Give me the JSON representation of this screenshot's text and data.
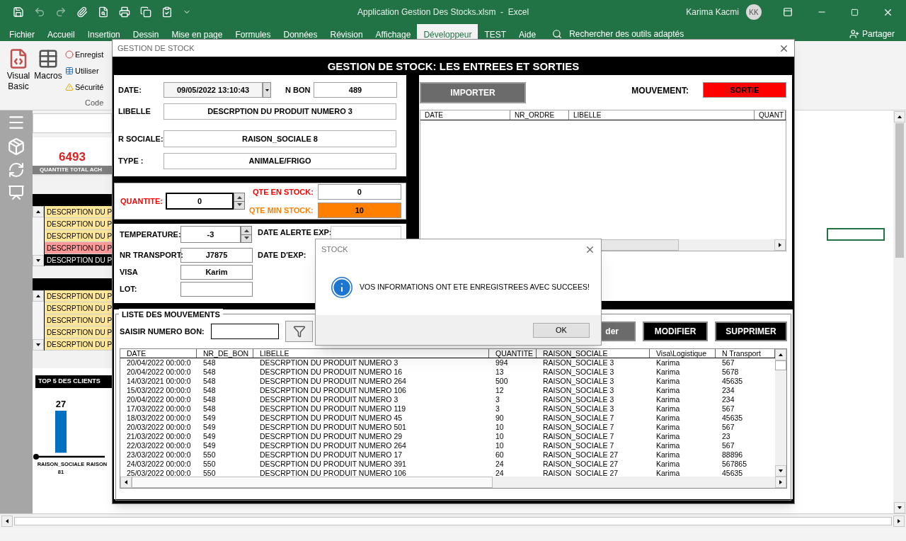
{
  "title_bar": {
    "title": "Application Gestion Des Stocks.xlsm  -  Excel",
    "user": "Karima Kacmi",
    "avatar": "KK"
  },
  "ribbon_tabs": [
    {
      "label": "Fichier",
      "selected": false
    },
    {
      "label": "Accueil",
      "selected": false
    },
    {
      "label": "Insertion",
      "selected": false
    },
    {
      "label": "Dessin",
      "selected": false
    },
    {
      "label": "Mise en page",
      "selected": false
    },
    {
      "label": "Formules",
      "selected": false
    },
    {
      "label": "Données",
      "selected": false
    },
    {
      "label": "Révision",
      "selected": false
    },
    {
      "label": "Affichage",
      "selected": false
    },
    {
      "label": "Développeur",
      "selected": true
    },
    {
      "label": "TEST",
      "selected": false
    },
    {
      "label": "Aide",
      "selected": false
    }
  ],
  "search": {
    "placeholder": "Rechercher des outils adaptés"
  },
  "share": "Partager",
  "ribbon": {
    "buttons": [
      "Visual Basic",
      "Macros"
    ],
    "commands": [
      "Enregist",
      "Utiliser",
      "Sécurité"
    ],
    "group": "Code"
  },
  "dashboard": {
    "kpi_value": "6493",
    "kpi_label": "QUANTITE TOTAL ACH",
    "list_1": [
      {
        "text": "DESCRPTION DU P",
        "color": "#ffe699"
      },
      {
        "text": "DESCRPTION DU P",
        "color": "#ffe699"
      },
      {
        "text": "DESCRPTION DU P",
        "color": "#ffe699"
      },
      {
        "text": "DESCRPTION DU P",
        "color": "#ff9999"
      },
      {
        "text": "DESCRPTION DU P",
        "color": "#000000"
      }
    ],
    "list_2": [
      {
        "text": "DESCRPTION DU P",
        "color": "#ffe699"
      },
      {
        "text": "DESCRPTION DU P",
        "color": "#ffe699"
      },
      {
        "text": "DESCRPTION DU P",
        "color": "#ffe699"
      },
      {
        "text": "DESCRPTION DU P",
        "color": "#ffe699"
      },
      {
        "text": "DESCRPTION DU P",
        "color": "#ffe699"
      }
    ],
    "chart": {
      "title": "TOP 5 DES CLIENTS",
      "chart_data": {
        "type": "bar",
        "categories": [
          "RAISON_SOCIALE 81",
          "RAISON"
        ],
        "values": [
          27,
          null
        ],
        "data_labels": true
      }
    }
  },
  "form": {
    "window_title": "GESTION DE STOCK",
    "header": "GESTION DE STOCK: LES ENTREES ET SORTIES",
    "date": {
      "label": "DATE:",
      "value": "09/05/2022 13:10:43"
    },
    "n_bon": {
      "label": "N BON",
      "value": "489"
    },
    "libelle": {
      "label": "LIBELLE",
      "value": "DESCRPTION DU PRODUIT NUMERO 3"
    },
    "r_sociale": {
      "label": "R SOCIALE:",
      "value": "RAISON_SOCIALE 8"
    },
    "type": {
      "label": "TYPE :",
      "value": "ANIMALE/FRIGO"
    },
    "quantite": {
      "label": "QUANTITE:",
      "value": "0"
    },
    "qte_en_stock": {
      "label": "QTE EN STOCK:",
      "value": "0"
    },
    "qte_min_stock": {
      "label": "QTE MIN STOCK:",
      "value": "10"
    },
    "temperature": {
      "label": "TEMPERATURE:",
      "value": "-3"
    },
    "date_alerte_exp": {
      "label": "DATE ALERTE EXP:"
    },
    "nr_transport": {
      "label": "NR TRANSPORT:",
      "value": "J7875"
    },
    "date_exp": {
      "label": "DATE D'EXP:"
    },
    "visa": {
      "label": "VISA",
      "value": "Karim"
    },
    "lot": {
      "label": "LOT:"
    },
    "import_button": "IMPORTER",
    "mouvement": {
      "label": "MOUVEMENT:",
      "value": "SORTIE"
    },
    "import_list": {
      "columns": [
        "DATE",
        "NR_ORDRE",
        "LIBELLE",
        "QUANT"
      ]
    },
    "movements": {
      "group_title": "LISTE DES MOUVEMENTS",
      "search_label": "SAISIR NUMERO BON:",
      "buttons": [
        "der",
        "MODIFIER",
        "SUPPRIMER"
      ],
      "columns": [
        "DATE",
        "NR_DE_BON",
        "LIBELLE",
        "QUANTITE",
        "RAISON_SOCIALE",
        "Visa\\Logistique",
        "N Transport"
      ],
      "rows": [
        [
          "20/04/2022 00:00:0",
          "548",
          "DESCRPTION DU PRODUIT NUMERO 3",
          "994",
          "RAISON_SOCIALE 3",
          "Karima",
          "567"
        ],
        [
          "20/04/2022 00:00:0",
          "548",
          "DESCRPTION DU PRODUIT NUMERO 16",
          "13",
          "RAISON_SOCIALE 3",
          "Karima",
          "5678"
        ],
        [
          "14/03/2021 00:00:0",
          "548",
          "DESCRPTION DU PRODUIT NUMERO 264",
          "500",
          "RAISON_SOCIALE 3",
          "Karima",
          "45635"
        ],
        [
          "15/03/2022 00:00:0",
          "548",
          "DESCRPTION DU PRODUIT NUMERO 106",
          "12",
          "RAISON_SOCIALE 3",
          "Karima",
          "234"
        ],
        [
          "20/04/2022 00:00:0",
          "548",
          "DESCRPTION DU PRODUIT NUMERO 3",
          "3",
          "RAISON_SOCIALE 3",
          "Karima",
          "234"
        ],
        [
          "17/03/2022 00:00:0",
          "548",
          "DESCRPTION DU PRODUIT NUMERO 119",
          "3",
          "RAISON_SOCIALE 3",
          "Karima",
          "567"
        ],
        [
          "18/03/2022 00:00:0",
          "549",
          "DESCRPTION DU PRODUIT NUMERO 45",
          "90",
          "RAISON_SOCIALE 7",
          "Karima",
          "45635"
        ],
        [
          "20/03/2022 00:00:0",
          "549",
          "DESCRPTION DU PRODUIT NUMERO 501",
          "10",
          "RAISON_SOCIALE 7",
          "Karima",
          "567"
        ],
        [
          "21/03/2022 00:00:0",
          "549",
          "DESCRPTION DU PRODUIT NUMERO 29",
          "10",
          "RAISON_SOCIALE 7",
          "Karima",
          "23"
        ],
        [
          "22/03/2022 00:00:0",
          "549",
          "DESCRPTION DU PRODUIT NUMERO 264",
          "10",
          "RAISON_SOCIALE 7",
          "Karima",
          "567"
        ],
        [
          "23/03/2022 00:00:0",
          "550",
          "DESCRPTION DU PRODUIT NUMERO 17",
          "60",
          "RAISON_SOCIALE 27",
          "Karima",
          "88896"
        ],
        [
          "24/03/2022 00:00:0",
          "550",
          "DESCRPTION DU PRODUIT NUMERO 391",
          "24",
          "RAISON_SOCIALE 27",
          "Karima",
          "567865"
        ],
        [
          "25/03/2022 00:00:0",
          "550",
          "DESCRPTION DU PRODUIT NUMERO 106",
          "24",
          "RAISON_SOCIALE 27",
          "Karima",
          "45635"
        ]
      ]
    }
  },
  "dialog": {
    "title": "STOCK",
    "message": "VOS INFORMATIONS ONT ETE ENREGISTREES AVEC SUCCEES!",
    "button": "OK"
  }
}
